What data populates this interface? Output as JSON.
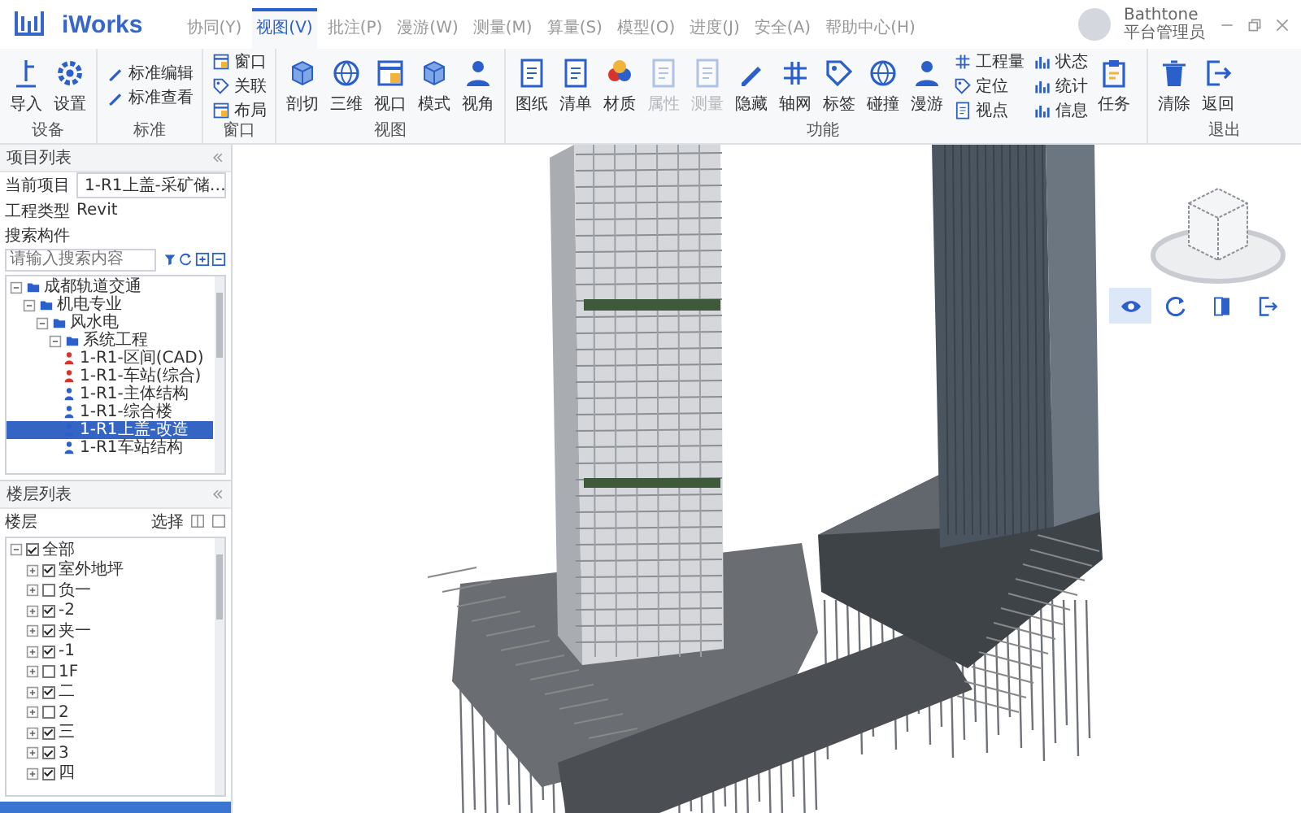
{
  "app": {
    "name": "iWorks"
  },
  "menu_tabs": [
    {
      "label": "协同(Y)",
      "selected": false
    },
    {
      "label": "视图(V)",
      "selected": true
    },
    {
      "label": "批注(P)",
      "selected": false
    },
    {
      "label": "漫游(W)",
      "selected": false
    },
    {
      "label": "测量(M)",
      "selected": false
    },
    {
      "label": "算量(S)",
      "selected": false
    },
    {
      "label": "模型(O)",
      "selected": false
    },
    {
      "label": "进度(J)",
      "selected": false
    },
    {
      "label": "安全(A)",
      "selected": false
    },
    {
      "label": "帮助中心(H)",
      "selected": false
    }
  ],
  "user": {
    "name": "Bathtone",
    "role": "平台管理员"
  },
  "ribbon": [
    {
      "label": "设备",
      "buttons": [
        {
          "label": "导入",
          "kind": "large",
          "disabled": false
        },
        {
          "label": "设置",
          "kind": "large",
          "disabled": false
        }
      ]
    },
    {
      "label": "标准",
      "buttons": [
        {
          "label": "标准编辑",
          "kind": "small",
          "disabled": false
        },
        {
          "label": "标准查看",
          "kind": "small",
          "disabled": false
        }
      ]
    },
    {
      "label": "窗口",
      "buttons": [
        {
          "label": "窗口",
          "kind": "small",
          "disabled": false
        },
        {
          "label": "关联",
          "kind": "small",
          "disabled": false
        },
        {
          "label": "布局",
          "kind": "small",
          "disabled": false
        }
      ]
    },
    {
      "label": "视图",
      "buttons": [
        {
          "label": "剖切",
          "kind": "large",
          "disabled": false
        },
        {
          "label": "三维",
          "kind": "large",
          "disabled": false
        },
        {
          "label": "视口",
          "kind": "large",
          "disabled": false
        },
        {
          "label": "模式",
          "kind": "large",
          "disabled": false
        },
        {
          "label": "视角",
          "kind": "large",
          "disabled": false
        }
      ]
    },
    {
      "label": "功能",
      "buttons": [
        {
          "label": "图纸",
          "kind": "large",
          "disabled": false
        },
        {
          "label": "清单",
          "kind": "large",
          "disabled": false
        },
        {
          "label": "材质",
          "kind": "large",
          "disabled": false
        },
        {
          "label": "属性",
          "kind": "large",
          "disabled": true
        },
        {
          "label": "测量",
          "kind": "large",
          "disabled": true
        },
        {
          "label": "隐藏",
          "kind": "large",
          "disabled": false
        },
        {
          "label": "轴网",
          "kind": "large",
          "disabled": false
        },
        {
          "label": "标签",
          "kind": "large",
          "disabled": false
        },
        {
          "label": "碰撞",
          "kind": "large",
          "disabled": false
        },
        {
          "label": "漫游",
          "kind": "large",
          "disabled": false
        },
        {
          "label": "工程量",
          "kind": "small",
          "disabled": false
        },
        {
          "label": "定位",
          "kind": "small",
          "disabled": false
        },
        {
          "label": "视点",
          "kind": "small",
          "disabled": false
        },
        {
          "label": "状态",
          "kind": "small",
          "disabled": false
        },
        {
          "label": "统计",
          "kind": "small",
          "disabled": false
        },
        {
          "label": "信息",
          "kind": "small",
          "disabled": false
        },
        {
          "label": "任务",
          "kind": "large",
          "disabled": false
        }
      ]
    },
    {
      "label": "退出",
      "buttons": [
        {
          "label": "清除",
          "kind": "large",
          "disabled": false
        },
        {
          "label": "返回",
          "kind": "large",
          "disabled": false
        }
      ]
    }
  ],
  "project_panel": {
    "title": "项目列表",
    "current_label": "当前项目",
    "current_project": "1-R1上盖-采矿储…",
    "type_label": "工程类型",
    "type_value": "Revit",
    "search_label": "搜索构件",
    "search": {
      "placeholder": "请输入搜索内容"
    },
    "tree": [
      {
        "label": "成都轨道交通",
        "expanded": true,
        "selected": false,
        "children": [
          {
            "label": "机电专业",
            "expanded": true,
            "selected": false,
            "children": [
              {
                "label": "风水电",
                "expanded": true,
                "selected": false,
                "children": [
                  {
                    "label": "系统工程",
                    "expanded": true,
                    "selected": false,
                    "children": [
                      {
                        "label": "1-R1-区间(CAD)",
                        "selected": false,
                        "color": "#d9342b"
                      },
                      {
                        "label": "1-R1-车站(综合)",
                        "selected": false,
                        "color": "#d9342b"
                      },
                      {
                        "label": "1-R1-主体结构",
                        "selected": false,
                        "color": "#2b5fc9"
                      },
                      {
                        "label": "1-R1-综合楼",
                        "selected": false,
                        "color": "#2b5fc9"
                      },
                      {
                        "label": "1-R1上盖-改造",
                        "selected": true,
                        "color": "#2b5fc9"
                      },
                      {
                        "label": "1-R1车站结构",
                        "selected": false,
                        "color": "#2b5fc9"
                      }
                    ]
                  }
                ]
              }
            ]
          }
        ]
      }
    ]
  },
  "floor_panel": {
    "title": "楼层列表",
    "label": "楼层",
    "select_label": "选择",
    "floors": [
      {
        "label": "全部",
        "checked": true,
        "expanded": true,
        "children": [
          {
            "label": "室外地坪",
            "checked": true,
            "expanded": false
          },
          {
            "label": "负一",
            "checked": false,
            "expanded": false
          },
          {
            "label": "-2",
            "checked": true,
            "expanded": false
          },
          {
            "label": "夹一",
            "checked": true,
            "expanded": false
          },
          {
            "label": "-1",
            "checked": true,
            "expanded": false
          },
          {
            "label": "1F",
            "checked": false,
            "expanded": false
          },
          {
            "label": "二",
            "checked": true,
            "expanded": false
          },
          {
            "label": "2",
            "checked": false,
            "expanded": false
          },
          {
            "label": "三",
            "checked": true,
            "expanded": false
          },
          {
            "label": "3",
            "checked": true,
            "expanded": false
          },
          {
            "label": "四",
            "checked": true,
            "expanded": false
          }
        ]
      }
    ]
  },
  "viewport": {
    "tools": [
      {
        "selected": true
      },
      {
        "selected": false
      },
      {
        "selected": false
      },
      {
        "selected": false
      }
    ]
  }
}
